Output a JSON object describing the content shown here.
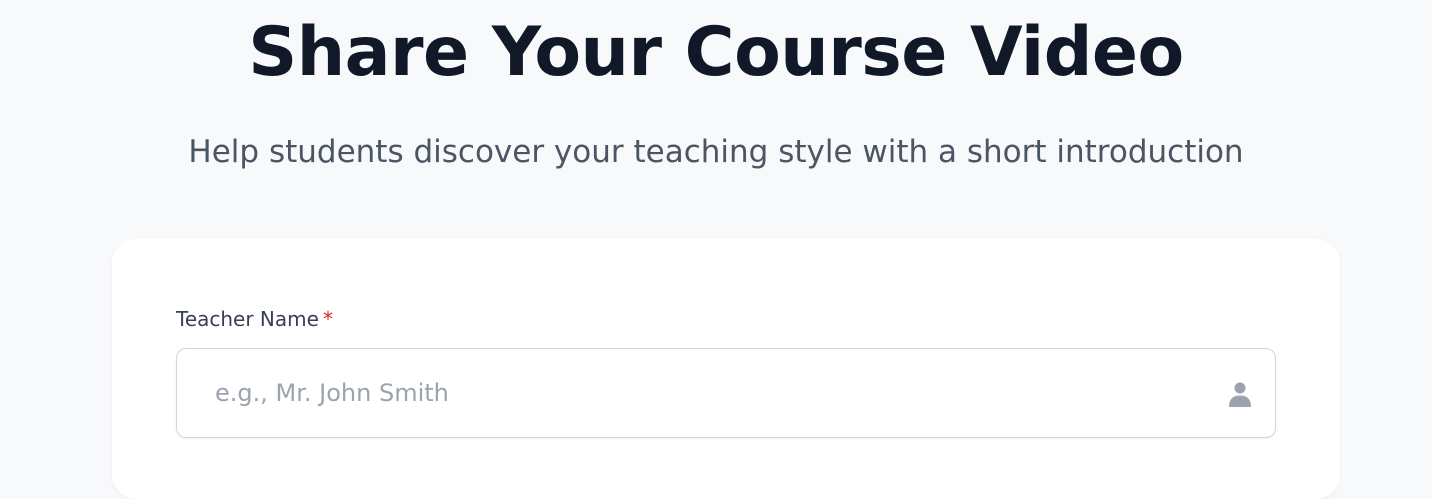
{
  "header": {
    "title": "Share Your Course Video",
    "subtitle": "Help students discover your teaching style with a short introduction"
  },
  "form": {
    "teacher_name": {
      "label": "Teacher Name",
      "required_mark": "*",
      "placeholder": "e.g., Mr. John Smith",
      "value": "",
      "icon": "user-icon"
    }
  },
  "colors": {
    "background": "#f8f9fb",
    "title": "#111827",
    "subtitle": "#4b5563",
    "required": "#dc2626",
    "placeholder": "#9ca3af",
    "icon": "#9ca3af"
  }
}
